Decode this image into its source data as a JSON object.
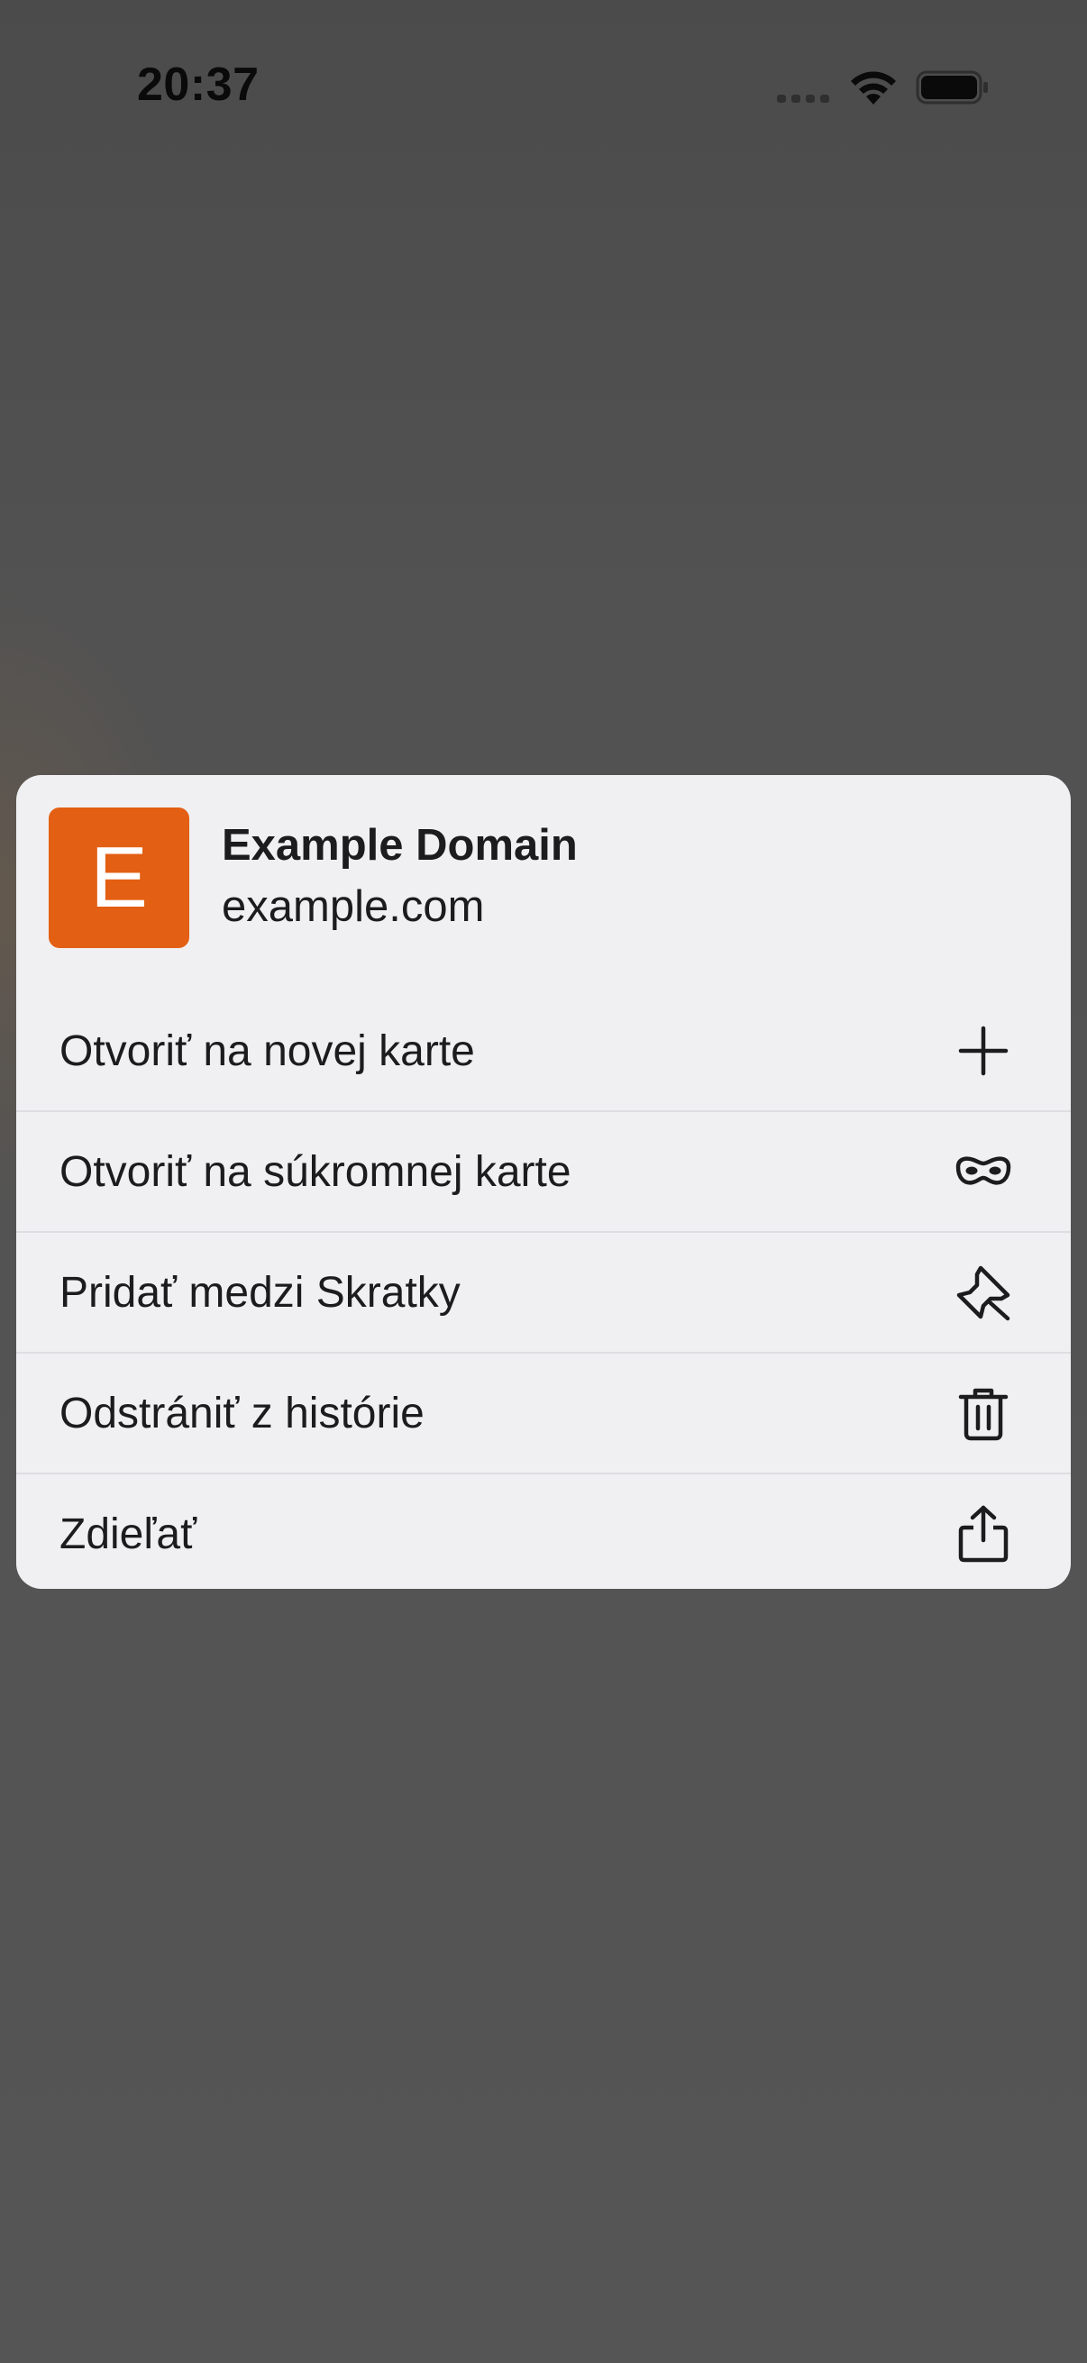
{
  "status_bar": {
    "time": "20:37"
  },
  "context_menu": {
    "site": {
      "favicon_letter": "E",
      "favicon_color": "#e35f13",
      "title": "Example Domain",
      "url": "example.com"
    },
    "items": [
      {
        "label": "Otvoriť na novej karte",
        "icon": "plus-icon"
      },
      {
        "label": "Otvoriť na súkromnej karte",
        "icon": "private-mask-icon"
      },
      {
        "label": "Pridať medzi Skratky",
        "icon": "pin-icon"
      },
      {
        "label": "Odstrániť z histórie",
        "icon": "trash-icon"
      },
      {
        "label": "Zdieľať",
        "icon": "share-icon"
      }
    ]
  }
}
